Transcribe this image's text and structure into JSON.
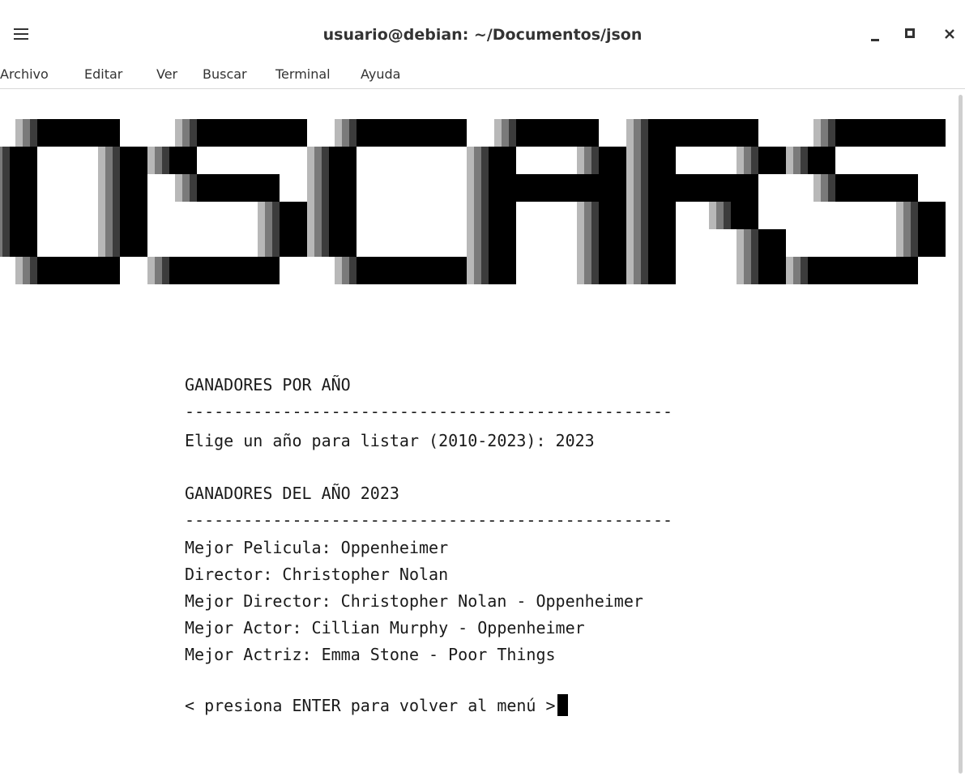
{
  "window": {
    "title": "usuario@debian: ~/Documentos/json",
    "menu_icon": "hamburger-icon",
    "minimize_icon": "minimize-icon",
    "maximize_icon": "maximize-icon",
    "close_icon": "close-icon"
  },
  "menubar": {
    "items": [
      "Archivo",
      "Editar",
      "Ver",
      "Buscar",
      "Terminal",
      "Ayuda"
    ]
  },
  "terminal": {
    "banner_text": "OSCARS",
    "heading": "GANADORES POR AÑO",
    "separator": "--------------------------------------------------",
    "prompt": "Elige un año para listar (2010-2023): 2023",
    "results_heading": "GANADORES DEL AÑO 2023",
    "results_separator": "--------------------------------------------------",
    "results": [
      "Mejor Pelicula: Oppenheimer",
      "Director: Christopher Nolan",
      "Mejor Director: Christopher Nolan - Oppenheimer",
      "Mejor Actor: Cillian Murphy - Oppenheimer",
      "Mejor Actriz: Emma Stone - Poor Things"
    ],
    "footer": "< presiona ENTER para volver al menú >"
  },
  "colors": {
    "banner_shades": [
      "#000000",
      "#3c3c3c",
      "#7a7a7a",
      "#b8b8b8"
    ]
  }
}
